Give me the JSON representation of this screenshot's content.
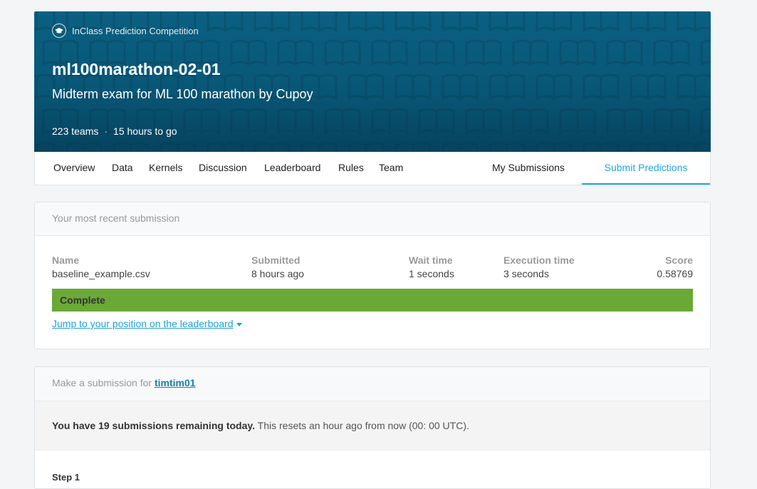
{
  "header": {
    "badge": "InClass Prediction Competition",
    "title": "ml100marathon-02-01",
    "subtitle": "Midterm exam for ML 100 marathon by Cupoy",
    "teams": "223 teams",
    "separator": "·",
    "time_left": "15 hours to go",
    "colors": {
      "banner": "#0a6082",
      "pattern": "#0b5472"
    }
  },
  "tabs": {
    "items": [
      "Overview",
      "Data",
      "Kernels",
      "Discussion",
      "Leaderboard",
      "Rules",
      "Team"
    ],
    "my_submissions": "My Submissions",
    "submit_predictions": "Submit Predictions",
    "active_color": "#20a5e0"
  },
  "recent": {
    "heading": "Your most recent submission",
    "columns": [
      {
        "label": "Name",
        "value": "baseline_example.csv"
      },
      {
        "label": "Submitted",
        "value": "8 hours ago"
      },
      {
        "label": "Wait time",
        "value": "1 seconds"
      },
      {
        "label": "Execution time",
        "value": "3 seconds"
      },
      {
        "label": "Score",
        "value": "0.58769"
      }
    ],
    "status": "Complete",
    "status_color": "#6aa936",
    "jump_link": "Jump to your position on the leaderboard"
  },
  "make_submission": {
    "prefix": "Make a submission for",
    "team": "timtim01",
    "remaining_bold": "You have 19 submissions remaining today.",
    "remaining_rest": " This resets an hour ago from now (00: 00 UTC).",
    "step": "Step 1"
  }
}
